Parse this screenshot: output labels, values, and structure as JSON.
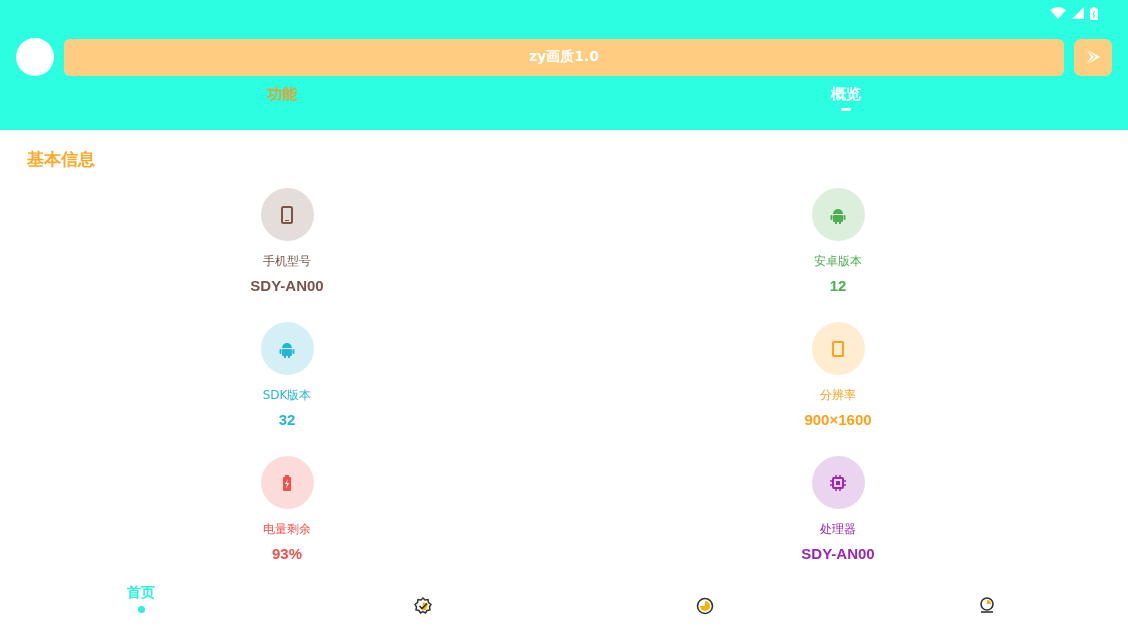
{
  "header": {
    "title": "zy画质1.0"
  },
  "tabs": [
    {
      "label": "功能",
      "selected": false
    },
    {
      "label": "概览",
      "selected": true
    }
  ],
  "section": {
    "title": "基本信息"
  },
  "info_items": [
    {
      "kind": "phone",
      "label": "手机型号",
      "value": "SDY-AN00",
      "color": "#795548"
    },
    {
      "kind": "android",
      "label": "安卓版本",
      "value": "12",
      "color": "#4caf50"
    },
    {
      "kind": "android",
      "label": "SDK版本",
      "value": "32",
      "color": "#26b6d4"
    },
    {
      "kind": "screen",
      "label": "分辨率",
      "value": "900×1600",
      "color": "#ff9f1a"
    },
    {
      "kind": "battery",
      "label": "电量剩余",
      "value": "93%",
      "color": "#f2504b"
    },
    {
      "kind": "chip",
      "label": "处理器",
      "value": "SDY-AN00",
      "color": "#9c27b0"
    }
  ],
  "bottom_nav": [
    {
      "label": "首页",
      "selected": true
    },
    {
      "kind": "badge",
      "selected": false
    },
    {
      "kind": "chart",
      "selected": false
    },
    {
      "kind": "bulb",
      "selected": false
    }
  ]
}
